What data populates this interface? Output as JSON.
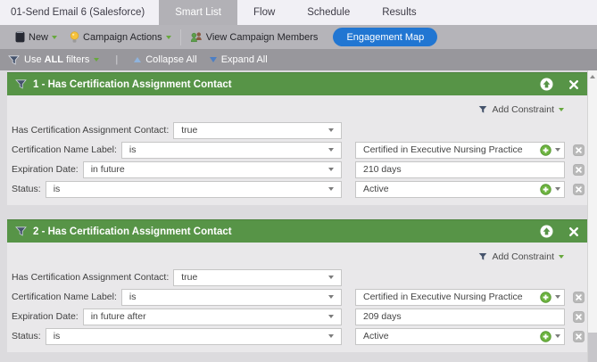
{
  "tabbar": {
    "title": "01-Send Email 6 (Salesforce)",
    "tabs": [
      {
        "label": "Smart List",
        "active": true
      },
      {
        "label": "Flow",
        "active": false
      },
      {
        "label": "Schedule",
        "active": false
      },
      {
        "label": "Results",
        "active": false
      }
    ]
  },
  "toolbar": {
    "new_label": "New",
    "campaign_actions_label": "Campaign Actions",
    "view_campaign_members_label": "View Campaign Members",
    "engagement_map_label": "Engagement Map"
  },
  "filterbar": {
    "use_prefix": "Use",
    "use_bold": "ALL",
    "use_suffix": "filters",
    "divider": "|",
    "collapse_all_label": "Collapse All",
    "expand_all_label": "Expand All"
  },
  "cards": [
    {
      "title": "1 - Has Certification Assignment Contact",
      "add_constraint_label": "Add Constraint",
      "rows": [
        {
          "label": "Has Certification Assignment Contact:",
          "operator": "true",
          "value": null,
          "has_add": false,
          "has_delete": false
        },
        {
          "label": "Certification Name Label:",
          "operator": "is",
          "value": "Certified in Executive Nursing Practice",
          "has_add": true,
          "has_delete": true
        },
        {
          "label": "Expiration Date:",
          "operator": "in future",
          "value": "210 days",
          "has_add": false,
          "has_delete": true
        },
        {
          "label": "Status:",
          "operator": "is",
          "value": "Active",
          "has_add": true,
          "has_delete": true
        }
      ]
    },
    {
      "title": "2 - Has Certification Assignment Contact",
      "add_constraint_label": "Add Constraint",
      "rows": [
        {
          "label": "Has Certification Assignment Contact:",
          "operator": "true",
          "value": null,
          "has_add": false,
          "has_delete": false
        },
        {
          "label": "Certification Name Label:",
          "operator": "is",
          "value": "Certified in Executive Nursing Practice",
          "has_add": true,
          "has_delete": true
        },
        {
          "label": "Expiration Date:",
          "operator": "in future after",
          "value": "209 days",
          "has_add": false,
          "has_delete": true
        },
        {
          "label": "Status:",
          "operator": "is",
          "value": "Active",
          "has_add": true,
          "has_delete": true
        }
      ]
    }
  ],
  "colors": {
    "card_header_green": "#579447",
    "engagement_map_blue": "#2176d2",
    "add_icon_green": "#6cb33f",
    "toolbar_gray": "#b5b4b9",
    "filterbar_gray": "#98979c"
  }
}
